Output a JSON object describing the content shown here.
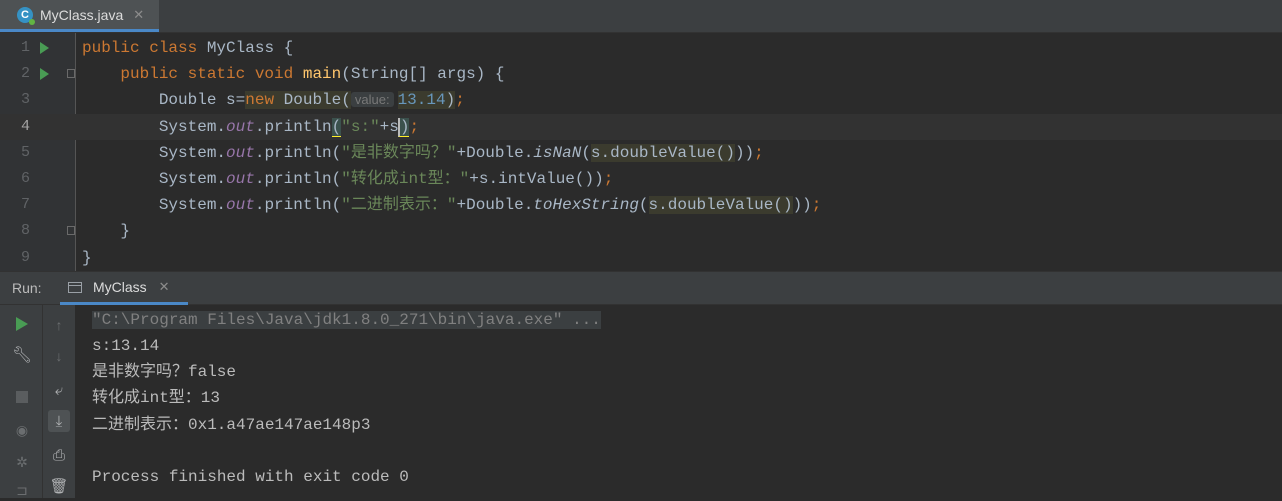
{
  "editor_tab": {
    "title": "MyClass.java",
    "icon_letter": "C",
    "close": "✕"
  },
  "code_lines": [
    {
      "num": "1",
      "segments": [
        {
          "t": "public class ",
          "c": "kw"
        },
        {
          "t": "MyClass {",
          "c": ""
        }
      ]
    },
    {
      "num": "2",
      "segments": [
        {
          "t": "    public static void ",
          "c": "kw"
        },
        {
          "t": "main",
          "c": "fn"
        },
        {
          "t": "(String[] args) {",
          "c": ""
        }
      ]
    },
    {
      "num": "3",
      "segments": [
        {
          "t": "        Double s=",
          "c": ""
        },
        {
          "t": "new ",
          "c": "kw hl"
        },
        {
          "t": "Double(",
          "c": "hl"
        },
        {
          "t": "value:",
          "c": "hint"
        },
        {
          "t": "13.14",
          "c": "num hl"
        },
        {
          "t": ")",
          "c": "hl"
        },
        {
          "t": ";",
          "c": "kw"
        }
      ]
    },
    {
      "num": "4",
      "segments": [
        {
          "t": "        System.",
          "c": ""
        },
        {
          "t": "out",
          "c": "fld"
        },
        {
          "t": ".println",
          "c": ""
        },
        {
          "t": "(",
          "c": "brace-match"
        },
        {
          "t": "\"s:\"",
          "c": "str"
        },
        {
          "t": "+s",
          "c": ""
        },
        {
          "t": ")",
          "c": "brace-match caret"
        },
        {
          "t": ";",
          "c": "kw"
        }
      ]
    },
    {
      "num": "5",
      "segments": [
        {
          "t": "        System.",
          "c": ""
        },
        {
          "t": "out",
          "c": "fld"
        },
        {
          "t": ".println(",
          "c": ""
        },
        {
          "t": "\"是非数字吗？\"",
          "c": "str"
        },
        {
          "t": "+Double.",
          "c": ""
        },
        {
          "t": "isNaN",
          "c": "sm"
        },
        {
          "t": "(",
          "c": ""
        },
        {
          "t": "s.doubleValue()",
          "c": "hl"
        },
        {
          "t": "))",
          "c": ""
        },
        {
          "t": ";",
          "c": "kw"
        }
      ]
    },
    {
      "num": "6",
      "segments": [
        {
          "t": "        System.",
          "c": ""
        },
        {
          "t": "out",
          "c": "fld"
        },
        {
          "t": ".println(",
          "c": ""
        },
        {
          "t": "\"转化成int型：\"",
          "c": "str"
        },
        {
          "t": "+s.intValue())",
          "c": ""
        },
        {
          "t": ";",
          "c": "kw"
        }
      ]
    },
    {
      "num": "7",
      "segments": [
        {
          "t": "        System.",
          "c": ""
        },
        {
          "t": "out",
          "c": "fld"
        },
        {
          "t": ".println(",
          "c": ""
        },
        {
          "t": "\"二进制表示：\"",
          "c": "str"
        },
        {
          "t": "+Double.",
          "c": ""
        },
        {
          "t": "toHexString",
          "c": "sm"
        },
        {
          "t": "(",
          "c": ""
        },
        {
          "t": "s.doubleValue()",
          "c": "hl"
        },
        {
          "t": "))",
          "c": ""
        },
        {
          "t": ";",
          "c": "kw"
        }
      ]
    },
    {
      "num": "8",
      "segments": [
        {
          "t": "    }",
          "c": ""
        }
      ]
    },
    {
      "num": "9",
      "segments": [
        {
          "t": "}",
          "c": ""
        }
      ]
    }
  ],
  "run_panel": {
    "label": "Run:",
    "tab_title": "MyClass",
    "tab_close": "✕",
    "command": "\"C:\\Program Files\\Java\\jdk1.8.0_271\\bin\\java.exe\" ...",
    "output_lines": [
      "s:13.14",
      "是非数字吗？false",
      "转化成int型：13",
      "二进制表示：0x1.a47ae147ae148p3",
      "",
      "Process finished with exit code 0"
    ]
  },
  "colors": {
    "accent": "#4a88c7",
    "run_green": "#499c54",
    "keyword": "#cc7832",
    "string": "#6a8759"
  }
}
